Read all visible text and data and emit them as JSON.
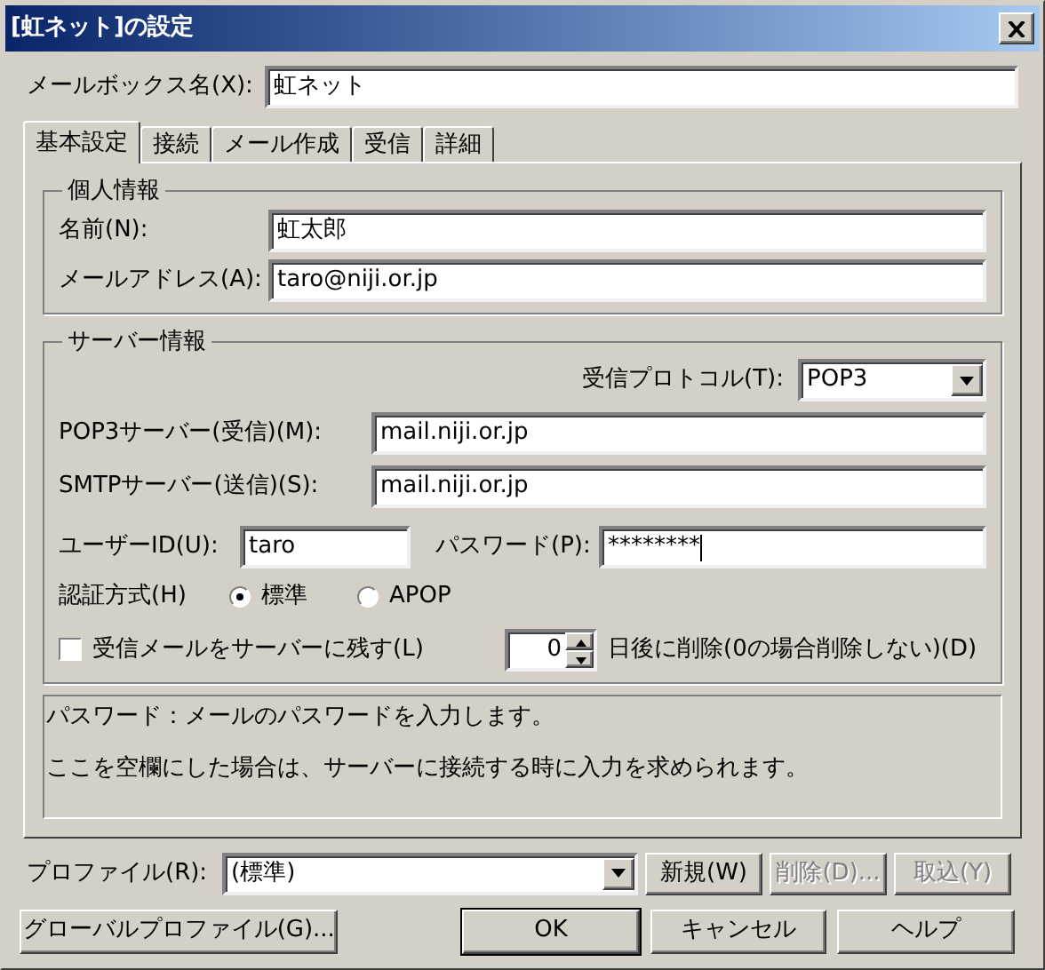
{
  "window": {
    "title": "[虹ネット]の設定"
  },
  "mailbox_name": {
    "label": "メールボックス名(X):",
    "value": "虹ネット"
  },
  "tabs": [
    {
      "label": "基本設定",
      "selected": true
    },
    {
      "label": "接続",
      "selected": false
    },
    {
      "label": "メール作成",
      "selected": false
    },
    {
      "label": "受信",
      "selected": false
    },
    {
      "label": "詳細",
      "selected": false
    }
  ],
  "personal": {
    "title": "個人情報",
    "fields": [
      {
        "label": "名前(N):",
        "value": "虹太郎"
      },
      {
        "label": "メールアドレス(A):",
        "value": "taro@niji.or.jp"
      }
    ]
  },
  "server": {
    "title": "サーバー情報",
    "protocol": {
      "label": "受信プロトコル(T):",
      "value": "POP3"
    },
    "fields": [
      {
        "label": "POP3サーバー(受信)(M):",
        "value": "mail.niji.or.jp"
      },
      {
        "label": "SMTPサーバー(送信)(S):",
        "value": "mail.niji.or.jp"
      }
    ],
    "user_id": {
      "label": "ユーザーID(U):",
      "value": "taro"
    },
    "password": {
      "label": "パスワード(P):",
      "value": "********",
      "focused": true
    },
    "auth": {
      "label": "認証方式(H)",
      "options": [
        {
          "label": "標準",
          "selected": true
        },
        {
          "label": "APOP",
          "selected": false
        }
      ]
    },
    "leave_on_server": {
      "label": "受信メールをサーバーに残す(L)",
      "checked": false,
      "days": "0",
      "suffix": "日後に削除(0の場合削除しない)(D)"
    }
  },
  "help_text": [
    "パスワード：メールのパスワードを入力します。",
    "ここを空欄にした場合は、サーバーに接続する時に入力を求められます。"
  ],
  "profile": {
    "label": "プロファイル(R):",
    "value": "(標準)",
    "buttons": [
      {
        "label": "新規(W)",
        "disabled": false
      },
      {
        "label": "削除(D)...",
        "disabled": true
      },
      {
        "label": "取込(Y)",
        "disabled": true
      }
    ]
  },
  "buttons": [
    {
      "label": "グローバルプロファイル(G)...",
      "default": false
    },
    {
      "label": "OK",
      "default": true
    },
    {
      "label": "キャンセル",
      "default": false
    },
    {
      "label": "ヘルプ",
      "default": false
    }
  ]
}
